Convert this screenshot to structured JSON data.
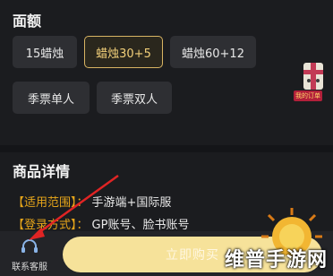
{
  "amount": {
    "title": "面额",
    "options": [
      {
        "label": "15蜡烛",
        "selected": false
      },
      {
        "label": "蜡烛30+5",
        "selected": true
      },
      {
        "label": "蜡烛60+12",
        "selected": false
      },
      {
        "label": "季票单人",
        "selected": false
      },
      {
        "label": "季票双人",
        "selected": false
      }
    ]
  },
  "details": {
    "title": "商品详情",
    "lines": [
      {
        "key": "【适用范围】",
        "sep": "：",
        "value": "手游端+国际服"
      },
      {
        "key": "【登录方式】",
        "sep": "：",
        "value": "GP账号、脸书账号"
      }
    ]
  },
  "bottom": {
    "customer_service_label": "联系客服",
    "buy_label": "立即购买"
  },
  "badge": {
    "text": "我的订单"
  },
  "watermark": {
    "text": "维普手游网"
  },
  "colors": {
    "background": "#1b1c1f",
    "option_bg": "#2e2f33",
    "selected_border": "#d8b463",
    "selected_text": "#f1cf79",
    "detail_key": "#e6a51a",
    "buy_button": "#f6e29a",
    "arrow": "#e02424"
  }
}
